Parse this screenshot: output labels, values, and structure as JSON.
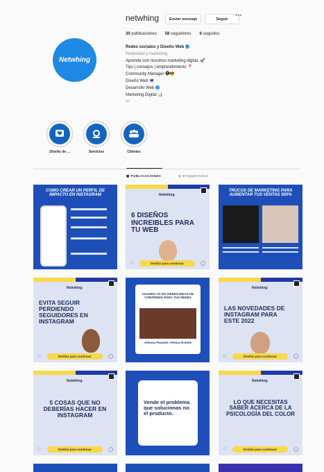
{
  "profile": {
    "username": "netwhing",
    "avatar_text": "Netwhing",
    "message_label": "Enviar mensaje",
    "follow_label": "Seguir",
    "more_label": "···",
    "stats": {
      "posts_count": "30",
      "posts_label": "publicaciones",
      "followers_count": "58",
      "followers_label": "seguidores",
      "following_count": "6",
      "following_label": "seguidos"
    },
    "bio": {
      "name": "Redes sociales y Diseño Web",
      "category": "Publicidad y marketing",
      "line1": "Aprende con nosotros marketing digital. 🚀",
      "line2": "Tips | consejos | emprendimiento 📍",
      "line3": "Community Manager 🅧😎",
      "line4": "Diseño Web 💻",
      "line5": "Desarrollo Web",
      "line6": "Marketing Digital 📊",
      "more": "sv"
    }
  },
  "highlights": [
    {
      "label": "Diseño de ...",
      "icon": "heart-chat-icon"
    },
    {
      "label": "Servicios",
      "icon": "gear-hand-icon"
    },
    {
      "label": "Clientes",
      "icon": "group-icon"
    }
  ],
  "tabs": {
    "posts": "▦ PUBLICACIONES",
    "tagged": "◎ ETIQUETADAS"
  },
  "posts": [
    {
      "title": "COMO CREAR UN PERFIL DE IMPACTO EN INSTAGRAM",
      "bg": "#1e4fb8"
    },
    {
      "title": "6 DISEÑOS INCREIBLES PARA TU WEB",
      "brand": "Netwhing",
      "swipe": "Deslíza para continuar",
      "bg": "#dde3f2"
    },
    {
      "title": "TRUCOS DE MARKETING PARA AUMENTAR TUS VENTAS 500%",
      "bg": "#1e4fb8"
    },
    {
      "title": "EVITA SEGUIR PERDIENDO SEGUIDORES EN INSTAGRAM",
      "brand": "Netwhing",
      "swipe": "Deslíza para continuar",
      "bg": "#dde3f2"
    },
    {
      "title": "CUANDO YA NO TIENES IDEAS DE CONTENIDO PARA TUS REDES",
      "caption": "¡PIENSA FRANKIE, PIENSA RIVERS!",
      "bg": "#1e4fb8"
    },
    {
      "title": "LAS NOVEDADES DE INSTAGRAM PARA ESTE 2022",
      "brand": "Netwhing",
      "swipe": "Deslíza para continuar",
      "bg": "#dde3f2"
    },
    {
      "title": "5 COSAS QUE NO DEBERÍAS HACER EN INSTAGRAM",
      "brand": "Netwhing",
      "swipe": "Deslíza para continuar",
      "bg": "#dde3f2"
    },
    {
      "title": "Vende el problema que solucionas no el producto.",
      "bg": "#1e4fb8"
    },
    {
      "title": "LO QUE NECESITAS SABER ACERCA DE LA PSICOLOGÍA DEL COLOR",
      "brand": "Netwhing",
      "swipe": "Deslíza para continuar",
      "bg": "#dde3f2"
    }
  ],
  "colors": {
    "brand_blue": "#1e4fb8",
    "accent_yellow": "#f9d84a",
    "light_bg": "#dde3f2"
  }
}
